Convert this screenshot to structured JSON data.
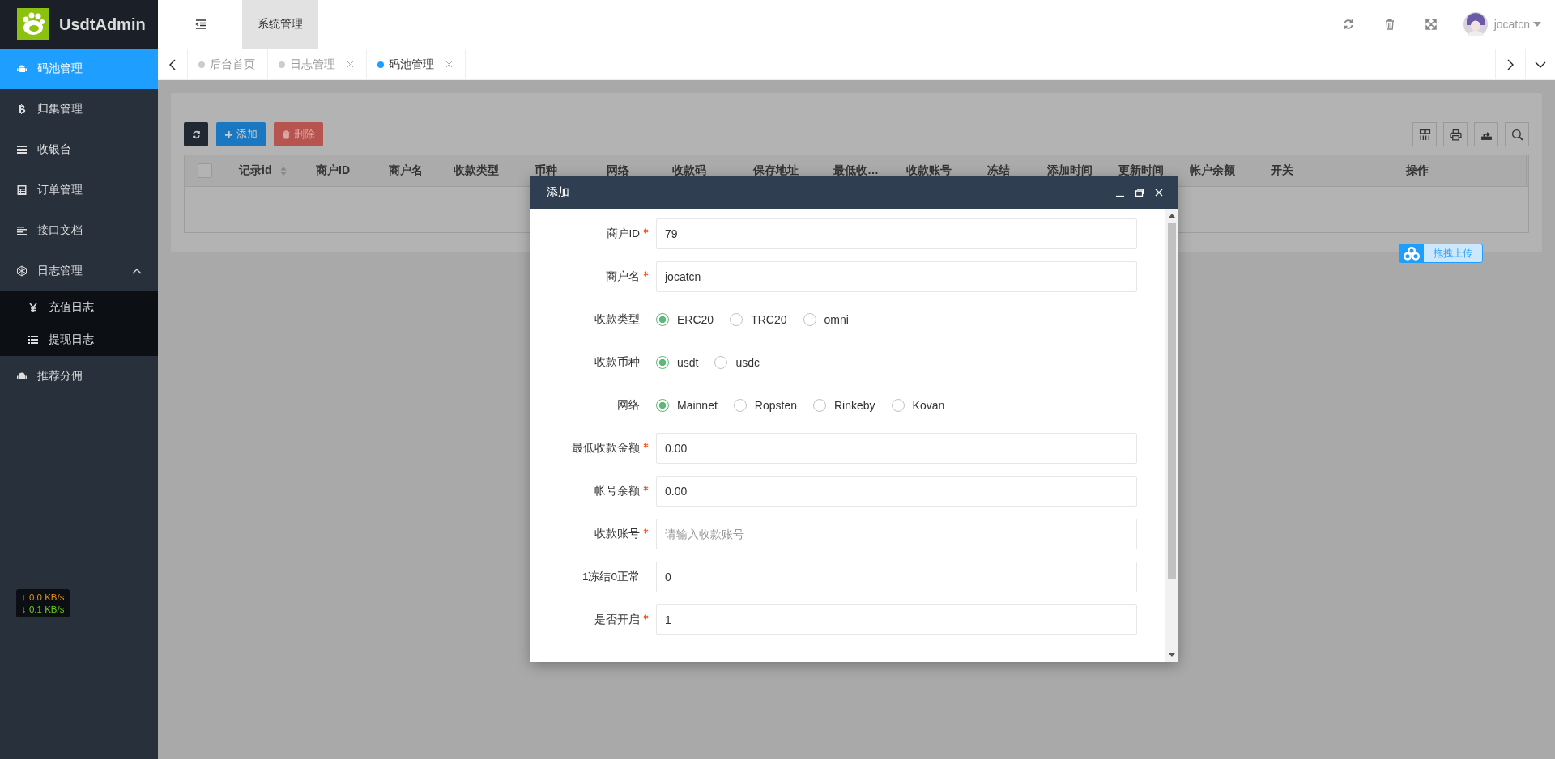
{
  "sidebar": {
    "logo_text": "UsdtAdmin",
    "items": [
      {
        "label": "码池管理",
        "selected": true
      },
      {
        "label": "归集管理",
        "selected": false
      },
      {
        "label": "收银台",
        "selected": false
      },
      {
        "label": "订单管理",
        "selected": false
      },
      {
        "label": "接口文档",
        "selected": false
      },
      {
        "label": "日志管理",
        "selected": false,
        "expanded": true,
        "children": [
          {
            "label": "充值日志",
            "selected": false
          },
          {
            "label": "提现日志",
            "selected": false
          }
        ]
      },
      {
        "label": "推荐分佣",
        "selected": false
      }
    ]
  },
  "net_speed": {
    "up": "↑ 0.0 KB/s",
    "down": "↓ 0.1 KB/s"
  },
  "header": {
    "menu": [
      {
        "label": "系统管理",
        "selected": true
      }
    ],
    "user": "jocatcn"
  },
  "tabs": [
    {
      "label": "后台首页",
      "selected": false,
      "closable": false
    },
    {
      "label": "日志管理",
      "selected": false,
      "closable": true
    },
    {
      "label": "码池管理",
      "selected": true,
      "closable": true
    }
  ],
  "toolbar": {
    "buttons": [
      {
        "kind": "refresh"
      },
      {
        "kind": "add",
        "label": "添加"
      },
      {
        "kind": "delete",
        "label": "删除"
      }
    ]
  },
  "table": {
    "select_all_checked": false,
    "columns": [
      {
        "label": "记录id",
        "sortable": true
      },
      {
        "label": "商户ID",
        "sortable": false
      },
      {
        "label": "商户名",
        "sortable": false
      },
      {
        "label": "收款类型",
        "sortable": false
      },
      {
        "label": "币种",
        "sortable": false
      },
      {
        "label": "网络",
        "sortable": false
      },
      {
        "label": "收款码",
        "sortable": false
      },
      {
        "label": "保存地址",
        "sortable": false
      },
      {
        "label": "最低收…",
        "sortable": false
      },
      {
        "label": "收款账号",
        "sortable": false
      },
      {
        "label": "冻结",
        "sortable": false
      },
      {
        "label": "添加时间",
        "sortable": false
      },
      {
        "label": "更新时间",
        "sortable": false
      },
      {
        "label": "帐户余额",
        "sortable": false
      },
      {
        "label": "开关",
        "sortable": false
      },
      {
        "label": "操作",
        "sortable": false
      }
    ]
  },
  "upload_button": "拖拽上传",
  "modal": {
    "title": "添加",
    "fields": [
      {
        "kind": "input",
        "label": "商户ID",
        "required": true,
        "value": "79"
      },
      {
        "kind": "input",
        "label": "商户名",
        "required": true,
        "value": "jocatcn"
      },
      {
        "kind": "radio",
        "label": "收款类型",
        "options": [
          {
            "label": "ERC20",
            "selected": true
          },
          {
            "label": "TRC20",
            "selected": false
          },
          {
            "label": "omni",
            "selected": false
          }
        ]
      },
      {
        "kind": "radio",
        "label": "收款币种",
        "options": [
          {
            "label": "usdt",
            "selected": true
          },
          {
            "label": "usdc",
            "selected": false
          }
        ]
      },
      {
        "kind": "radio",
        "label": "网络",
        "options": [
          {
            "label": "Mainnet",
            "selected": true
          },
          {
            "label": "Ropsten",
            "selected": false
          },
          {
            "label": "Rinkeby",
            "selected": false
          },
          {
            "label": "Kovan",
            "selected": false
          }
        ]
      },
      {
        "kind": "input",
        "label": "最低收款金额",
        "required": true,
        "value": "0.00"
      },
      {
        "kind": "input",
        "label": "帐号余额",
        "required": true,
        "value": "0.00"
      },
      {
        "kind": "input",
        "label": "收款账号",
        "required": true,
        "placeholder": "请输入收款账号"
      },
      {
        "kind": "input",
        "label": "1冻结0正常",
        "required": false,
        "value": "0"
      },
      {
        "kind": "input",
        "label": "是否开启",
        "required": true,
        "value": "1"
      }
    ]
  }
}
